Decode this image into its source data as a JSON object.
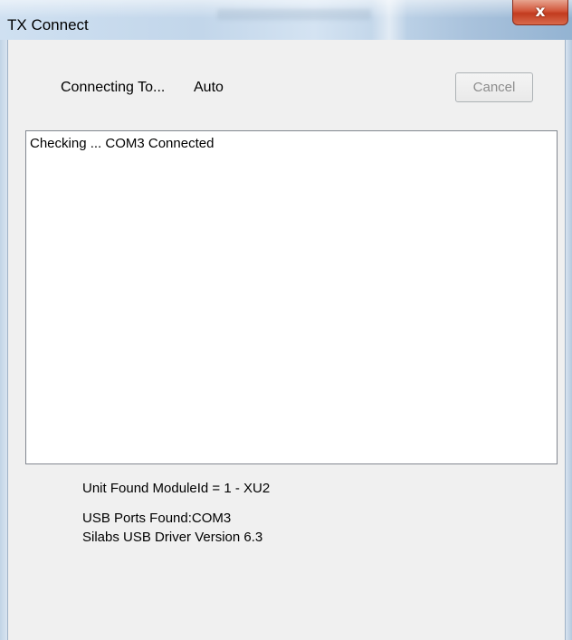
{
  "window": {
    "title": "TX Connect",
    "close_glyph": "x"
  },
  "connect": {
    "label": "Connecting To...",
    "value": "Auto",
    "cancel_label": "Cancel"
  },
  "log": {
    "lines": [
      "Checking ... COM3 Connected"
    ]
  },
  "info": {
    "unit_found": "Unit Found ModuleId = 1 - XU2",
    "usb_ports": "USB Ports Found:COM3",
    "driver_version": "Silabs USB Driver Version 6.3"
  },
  "colors": {
    "close_button": "#c23b1f",
    "title_bar": "#c2d6ea",
    "client_bg": "#f0f0f0",
    "disabled_text": "#8c8c8c"
  },
  "icons": {
    "close": "close-icon"
  }
}
